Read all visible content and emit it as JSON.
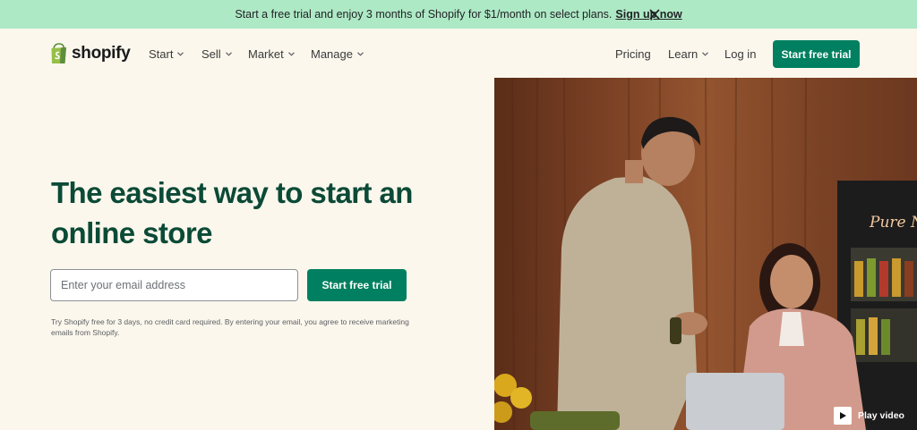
{
  "banner": {
    "message": "Start a free trial and enjoy 3 months of Shopify for $1/month on select plans.",
    "link": "Sign up now",
    "close_icon": "close-icon"
  },
  "nav": {
    "logo_text": "shopify",
    "items": [
      {
        "label": "Start"
      },
      {
        "label": "Sell"
      },
      {
        "label": "Market"
      },
      {
        "label": "Manage"
      }
    ],
    "right": {
      "pricing": "Pricing",
      "learn": "Learn",
      "login": "Log in",
      "cta": "Start free trial"
    }
  },
  "hero": {
    "title": "The easiest way to start an online store",
    "email_placeholder": "Enter your email address",
    "cta": "Start free trial",
    "disclaimer": "Try Shopify free for 3 days, no credit card required. By entering your email, you agree to receive marketing emails from Shopify."
  },
  "media": {
    "shop_sign": "Pure Ne",
    "play_label": "Play video"
  },
  "colors": {
    "banner_bg": "#aee9c5",
    "page_bg": "#fbf7ed",
    "brand_green": "#008060",
    "title_green": "#0b4a36"
  }
}
